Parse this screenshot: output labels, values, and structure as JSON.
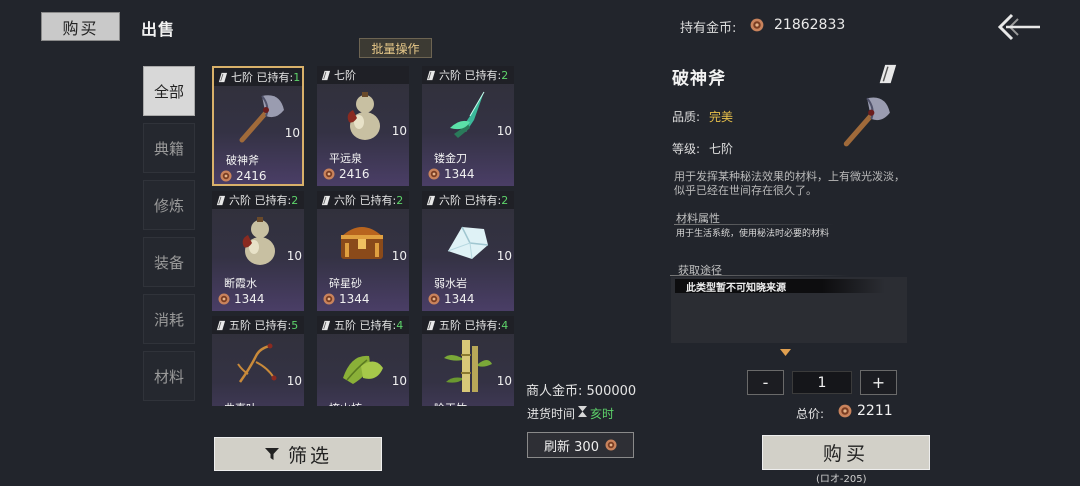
{
  "header": {
    "tab_buy": "购买",
    "tab_sell": "出售",
    "gold_label": "持有金币:",
    "gold_value": "21862833",
    "back_icon": "back-arrow-icon"
  },
  "batch_label": "批量操作",
  "categories": [
    "全部",
    "典籍",
    "修炼",
    "装备",
    "消耗",
    "材料"
  ],
  "active_category": 0,
  "items": [
    {
      "grade": "七阶",
      "owned_label": "已持有:",
      "owned": "1",
      "name": "破神斧",
      "qty": "10",
      "price": "2416",
      "icon": "axe-icon",
      "selected": true
    },
    {
      "grade": "七阶",
      "owned_label": "",
      "owned": "",
      "name": "平远泉",
      "qty": "10",
      "price": "2416",
      "icon": "gourd-icon",
      "selected": false
    },
    {
      "grade": "六阶",
      "owned_label": "已持有:",
      "owned": "2",
      "name": "镂金刀",
      "qty": "10",
      "price": "1344",
      "icon": "green-blade-icon",
      "selected": false
    },
    {
      "grade": "六阶",
      "owned_label": "已持有:",
      "owned": "2",
      "name": "断霞水",
      "qty": "10",
      "price": "1344",
      "icon": "gourd-icon",
      "selected": false
    },
    {
      "grade": "六阶",
      "owned_label": "已持有:",
      "owned": "2",
      "name": "碎星砂",
      "qty": "10",
      "price": "1344",
      "icon": "treasure-chest-icon",
      "selected": false
    },
    {
      "grade": "六阶",
      "owned_label": "已持有:",
      "owned": "2",
      "name": "弱水岩",
      "qty": "10",
      "price": "1344",
      "icon": "crystal-rock-icon",
      "selected": false
    },
    {
      "grade": "五阶",
      "owned_label": "已持有:",
      "owned": "5",
      "name": "曲直叶",
      "qty": "10",
      "price": "",
      "icon": "branch-icon",
      "selected": false
    },
    {
      "grade": "五阶",
      "owned_label": "已持有:",
      "owned": "4",
      "name": "掩山核",
      "qty": "10",
      "price": "",
      "icon": "green-seed-icon",
      "selected": false
    },
    {
      "grade": "五阶",
      "owned_label": "已持有:",
      "owned": "4",
      "name": "睑玉竹",
      "qty": "10",
      "price": "",
      "icon": "bamboo-icon",
      "selected": false
    }
  ],
  "merchant": {
    "gold_label": "商人金币:",
    "gold_value": "500000",
    "restock_label": "进货时间",
    "restock_value": "亥时",
    "refresh_label": "刷新 300"
  },
  "filter_label": "筛选",
  "detail": {
    "name": "破神斧",
    "quality_label": "品质:",
    "quality": "完美",
    "grade_label": "等级:",
    "grade": "七阶",
    "description": "用于发挥某种秘法效果的材料，上有微光泼淡，似乎已经在世间存在很久了。",
    "material_title": "材料属性",
    "material_text": "用于生活系统，使用秘法时必要的材料",
    "source_title": "获取途径",
    "source_text": "此类型暂不可知晓来源"
  },
  "purchase": {
    "minus": "-",
    "quantity": "1",
    "plus": "+",
    "total_label": "总价:",
    "total_value": "2211",
    "buy_label": "购买",
    "buy_hint": "(ロオ-205)"
  },
  "colors": {
    "owned_green": "#5dd36a",
    "quality_gold": "#e8c04a",
    "selected_border": "#d9b16a",
    "card_purple": "#4a3e66"
  }
}
